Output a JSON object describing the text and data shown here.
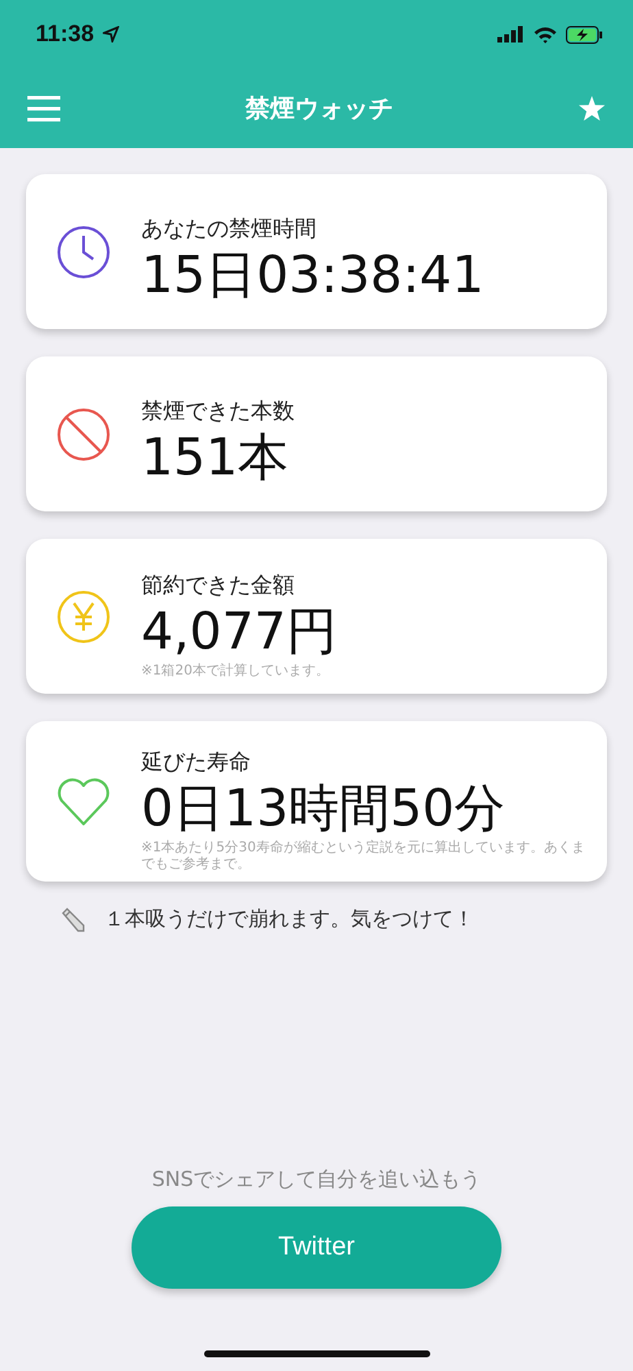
{
  "status_bar": {
    "time": "11:38"
  },
  "header": {
    "title": "禁煙ウォッチ"
  },
  "cards": [
    {
      "kind": "clock",
      "label": "あなたの禁煙時間",
      "value": "15日03:38:41"
    },
    {
      "kind": "ban",
      "label": "禁煙できた本数",
      "value": "151本"
    },
    {
      "kind": "yen",
      "label": "節約できた金額",
      "value": "4,077円",
      "note": "※1箱20本で計算しています。"
    },
    {
      "kind": "heart",
      "label": "延びた寿命",
      "value": "0日13時間50分",
      "note": "※1本あたり5分30寿命が縮むという定説を元に算出しています。あくまでもご参考まで。"
    }
  ],
  "tip": "１本吸うだけで崩れます。気をつけて！",
  "share": {
    "caption": "SNSでシェアして自分を追い込もう",
    "button": "Twitter"
  }
}
